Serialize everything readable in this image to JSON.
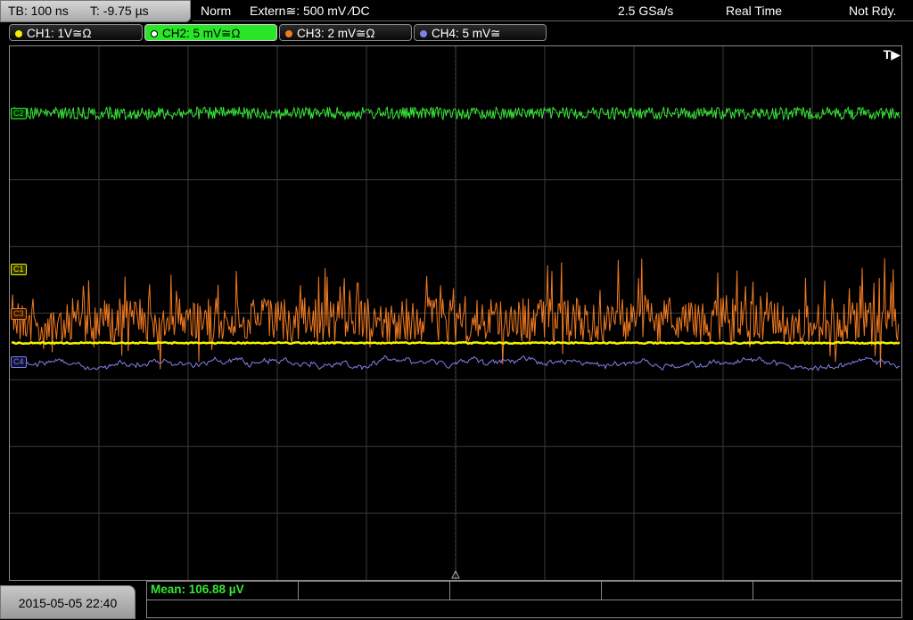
{
  "header": {
    "timebase": "TB: 100 ns",
    "trigger_pos": "T: -9.75 µs",
    "mode": "Norm",
    "trigger_source": "Extern≅: 500 mV ∕DC",
    "sample_rate": "2.5 GSa/s",
    "acq_mode": "Real Time",
    "status": "Not Rdy."
  },
  "channels": [
    {
      "label": "CH1: 1V≅Ω",
      "color": "#f2f200"
    },
    {
      "label": "CH2: 5 mV≅Ω",
      "color": "#35e635"
    },
    {
      "label": "CH3: 2 mV≅Ω",
      "color": "#f07a20"
    },
    {
      "label": "CH4: 5 mV≅",
      "color": "#8080e8"
    }
  ],
  "markers": {
    "trigger": "T▶",
    "c1": "C1",
    "c2": "C2",
    "c3": "C3",
    "c4": "C4"
  },
  "footer": {
    "datetime": "2015-05-05 22:40",
    "measurement": "Mean: 106.88 µV"
  },
  "colors": {
    "ch1": "#f2f200",
    "ch2": "#35e635",
    "ch3": "#f07a20",
    "ch4": "#8080e8",
    "grid": "#3a3a3a"
  }
}
